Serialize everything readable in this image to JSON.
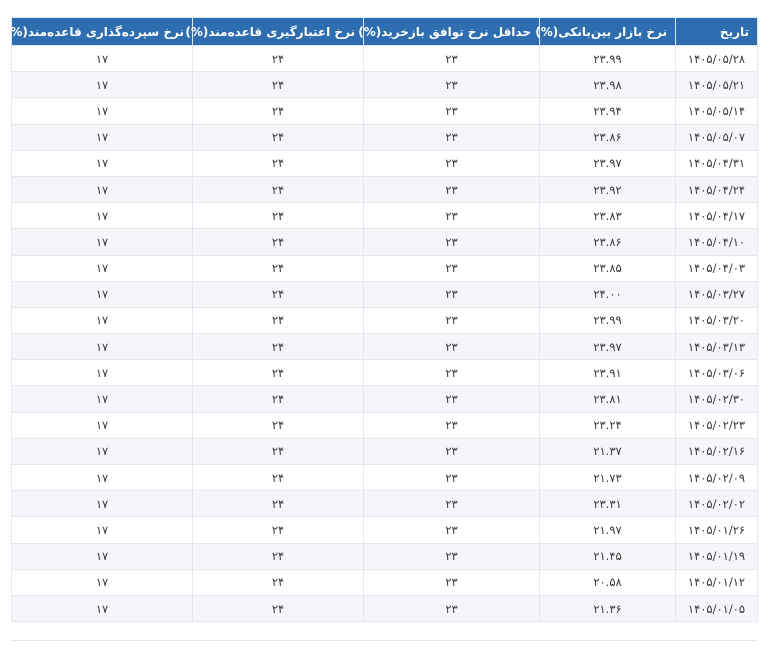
{
  "table": {
    "headers": {
      "date": "تاریخ",
      "interbank": "نرخ بازار بین‌بانکی(%)",
      "repo_min": "حداقل نرخ توافق بازخرید(%)",
      "credit": "نرخ اعتبارگیری قاعده‌مند(%)",
      "deposit": "نرخ سپرده‌گذاری قاعده‌مند(%)"
    },
    "rows": [
      {
        "date": "۱۴۰۵/۰۵/۲۸",
        "interbank": "۲۳.۹۹",
        "repo_min": "۲۳",
        "credit": "۲۴",
        "deposit": "۱۷"
      },
      {
        "date": "۱۴۰۵/۰۵/۲۱",
        "interbank": "۲۳.۹۸",
        "repo_min": "۲۳",
        "credit": "۲۴",
        "deposit": "۱۷"
      },
      {
        "date": "۱۴۰۵/۰۵/۱۴",
        "interbank": "۲۳.۹۴",
        "repo_min": "۲۳",
        "credit": "۲۴",
        "deposit": "۱۷"
      },
      {
        "date": "۱۴۰۵/۰۵/۰۷",
        "interbank": "۲۳.۸۶",
        "repo_min": "۲۳",
        "credit": "۲۴",
        "deposit": "۱۷"
      },
      {
        "date": "۱۴۰۵/۰۴/۳۱",
        "interbank": "۲۳.۹۷",
        "repo_min": "۲۳",
        "credit": "۲۴",
        "deposit": "۱۷"
      },
      {
        "date": "۱۴۰۵/۰۴/۲۴",
        "interbank": "۲۳.۹۲",
        "repo_min": "۲۳",
        "credit": "۲۴",
        "deposit": "۱۷"
      },
      {
        "date": "۱۴۰۵/۰۴/۱۷",
        "interbank": "۲۳.۸۳",
        "repo_min": "۲۳",
        "credit": "۲۴",
        "deposit": "۱۷"
      },
      {
        "date": "۱۴۰۵/۰۴/۱۰",
        "interbank": "۲۳.۸۶",
        "repo_min": "۲۳",
        "credit": "۲۴",
        "deposit": "۱۷"
      },
      {
        "date": "۱۴۰۵/۰۴/۰۳",
        "interbank": "۲۳.۸۵",
        "repo_min": "۲۳",
        "credit": "۲۴",
        "deposit": "۱۷"
      },
      {
        "date": "۱۴۰۵/۰۳/۲۷",
        "interbank": "۲۴.۰۰",
        "repo_min": "۲۳",
        "credit": "۲۴",
        "deposit": "۱۷"
      },
      {
        "date": "۱۴۰۵/۰۳/۲۰",
        "interbank": "۲۳.۹۹",
        "repo_min": "۲۳",
        "credit": "۲۴",
        "deposit": "۱۷"
      },
      {
        "date": "۱۴۰۵/۰۳/۱۳",
        "interbank": "۲۳.۹۷",
        "repo_min": "۲۳",
        "credit": "۲۴",
        "deposit": "۱۷"
      },
      {
        "date": "۱۴۰۵/۰۳/۰۶",
        "interbank": "۲۳.۹۱",
        "repo_min": "۲۳",
        "credit": "۲۴",
        "deposit": "۱۷"
      },
      {
        "date": "۱۴۰۵/۰۲/۳۰",
        "interbank": "۲۳.۸۱",
        "repo_min": "۲۳",
        "credit": "۲۴",
        "deposit": "۱۷"
      },
      {
        "date": "۱۴۰۵/۰۲/۲۳",
        "interbank": "۲۳.۲۴",
        "repo_min": "۲۳",
        "credit": "۲۴",
        "deposit": "۱۷"
      },
      {
        "date": "۱۴۰۵/۰۲/۱۶",
        "interbank": "۲۱.۳۷",
        "repo_min": "۲۳",
        "credit": "۲۴",
        "deposit": "۱۷"
      },
      {
        "date": "۱۴۰۵/۰۲/۰۹",
        "interbank": "۲۱.۷۳",
        "repo_min": "۲۳",
        "credit": "۲۴",
        "deposit": "۱۷"
      },
      {
        "date": "۱۴۰۵/۰۲/۰۲",
        "interbank": "۲۳.۳۱",
        "repo_min": "۲۳",
        "credit": "۲۴",
        "deposit": "۱۷"
      },
      {
        "date": "۱۴۰۵/۰۱/۲۶",
        "interbank": "۲۱.۹۷",
        "repo_min": "۲۳",
        "credit": "۲۴",
        "deposit": "۱۷"
      },
      {
        "date": "۱۴۰۵/۰۱/۱۹",
        "interbank": "۲۱.۴۵",
        "repo_min": "۲۳",
        "credit": "۲۴",
        "deposit": "۱۷"
      },
      {
        "date": "۱۴۰۵/۰۱/۱۲",
        "interbank": "۲۰.۵۸",
        "repo_min": "۲۳",
        "credit": "۲۴",
        "deposit": "۱۷"
      },
      {
        "date": "۱۴۰۵/۰۱/۰۵",
        "interbank": "۲۱.۳۶",
        "repo_min": "۲۳",
        "credit": "۲۴",
        "deposit": "۱۷"
      }
    ]
  },
  "colors": {
    "header_bg": "#2e6eb0",
    "header_text": "#ffffff",
    "stripe": "#f4f6f9"
  }
}
